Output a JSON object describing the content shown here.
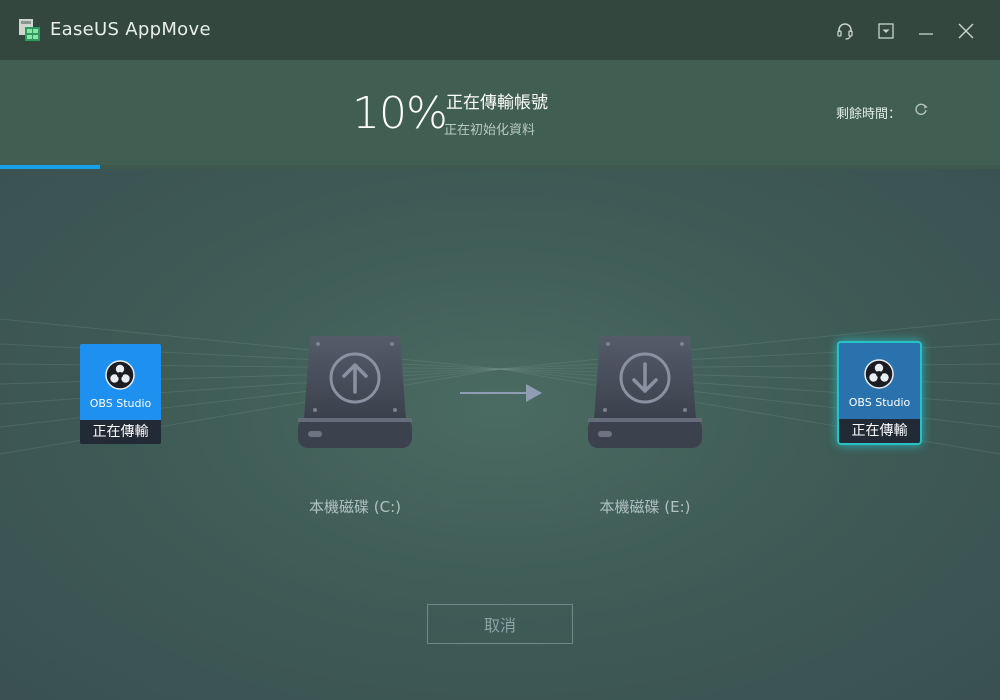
{
  "app": {
    "title": "EaseUS AppMove"
  },
  "progress": {
    "percent_label": "10%",
    "percent_value": 10,
    "status": "正在傳輸帳號",
    "substatus": "正在初始化資料",
    "remaining_label": "剩餘時間："
  },
  "transfer": {
    "source_app": {
      "name": "OBS Studio",
      "status": "正在傳輸"
    },
    "target_app": {
      "name": "OBS Studio",
      "status": "正在傳輸"
    },
    "source_drive": "本機磁碟 (C:)",
    "target_drive": "本機磁碟 (E:)"
  },
  "actions": {
    "cancel_label": "取消"
  },
  "colors": {
    "accent": "#1aa0e6",
    "highlight": "#27c2c4",
    "card": "#1e90ef"
  },
  "icons": [
    "app-logo-icon",
    "support-icon",
    "menu-dropdown-icon",
    "minimize-icon",
    "close-icon",
    "spinner-icon",
    "obs-icon",
    "upload-drive-icon",
    "download-drive-icon",
    "arrow-right-icon"
  ]
}
